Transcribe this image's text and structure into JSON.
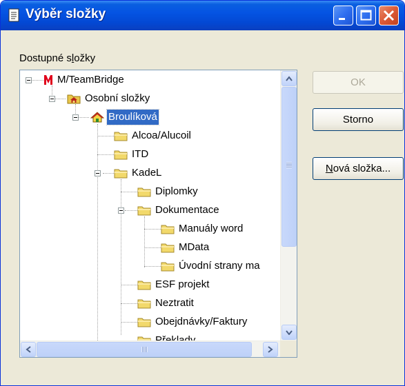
{
  "window": {
    "title": "Výběr složky",
    "colors": {
      "titlebar": "#0554e3",
      "face": "#ece9d8",
      "selection": "#316ac5"
    }
  },
  "label": {
    "pre": "Dostupné s",
    "accel": "l",
    "post": "ožky"
  },
  "tree": {
    "nodes": [
      {
        "label": "M/TeamBridge",
        "icon": "teambridge-m-icon",
        "selected": false
      },
      {
        "label": "Osobní složky",
        "icon": "home-folder-icon",
        "selected": false
      },
      {
        "label": "Broulíková",
        "icon": "house-icon",
        "selected": true
      },
      {
        "label": "Alcoa/Alucoil",
        "icon": "folder-icon",
        "selected": false
      },
      {
        "label": "ITD",
        "icon": "folder-icon",
        "selected": false
      },
      {
        "label": "KadeL",
        "icon": "folder-icon",
        "selected": false
      },
      {
        "label": "Diplomky",
        "icon": "folder-icon",
        "selected": false
      },
      {
        "label": "Dokumentace",
        "icon": "folder-icon",
        "selected": false
      },
      {
        "label": "Manuály word",
        "icon": "folder-icon",
        "selected": false
      },
      {
        "label": "MData",
        "icon": "folder-icon",
        "selected": false
      },
      {
        "label": "Úvodní strany ma",
        "icon": "folder-icon",
        "selected": false
      },
      {
        "label": "ESF projekt",
        "icon": "folder-icon",
        "selected": false
      },
      {
        "label": "Neztratit",
        "icon": "folder-icon",
        "selected": false
      },
      {
        "label": "Obejdnávky/Faktury",
        "icon": "folder-icon",
        "selected": false
      },
      {
        "label": "Překlady",
        "icon": "folder-icon",
        "selected": false
      }
    ]
  },
  "buttons": {
    "ok": "OK",
    "cancel": "Storno",
    "new_folder": {
      "accel": "N",
      "rest": "ová složka..."
    }
  }
}
